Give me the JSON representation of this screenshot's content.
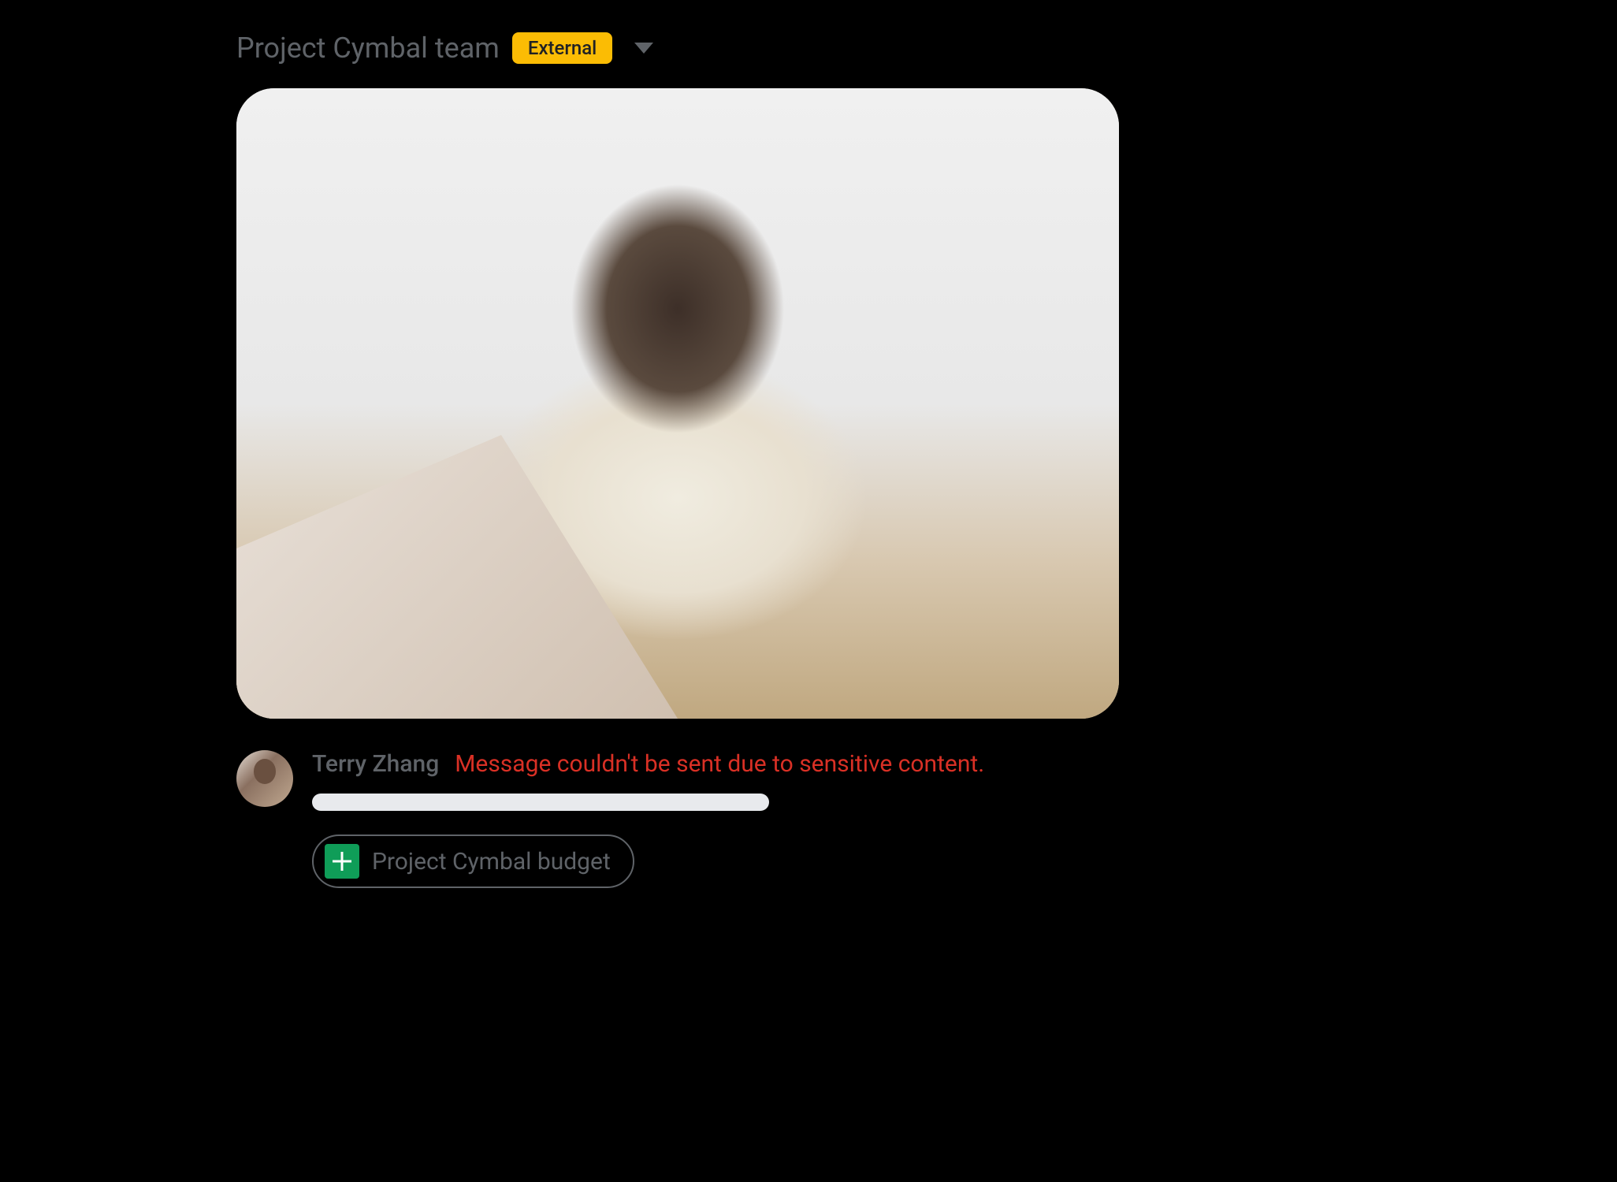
{
  "header": {
    "space_title": "Project Cymbal team",
    "external_badge": "External"
  },
  "message": {
    "sender_name": "Terry Zhang",
    "error_text": "Message couldn't be sent due to sensitive content.",
    "attachment": {
      "type": "sheets",
      "name": "Project Cymbal budget"
    }
  },
  "colors": {
    "background": "#000000",
    "text_muted": "#5f6368",
    "badge_bg": "#fbbc04",
    "error": "#d93025",
    "sheets_green": "#0f9d58"
  }
}
